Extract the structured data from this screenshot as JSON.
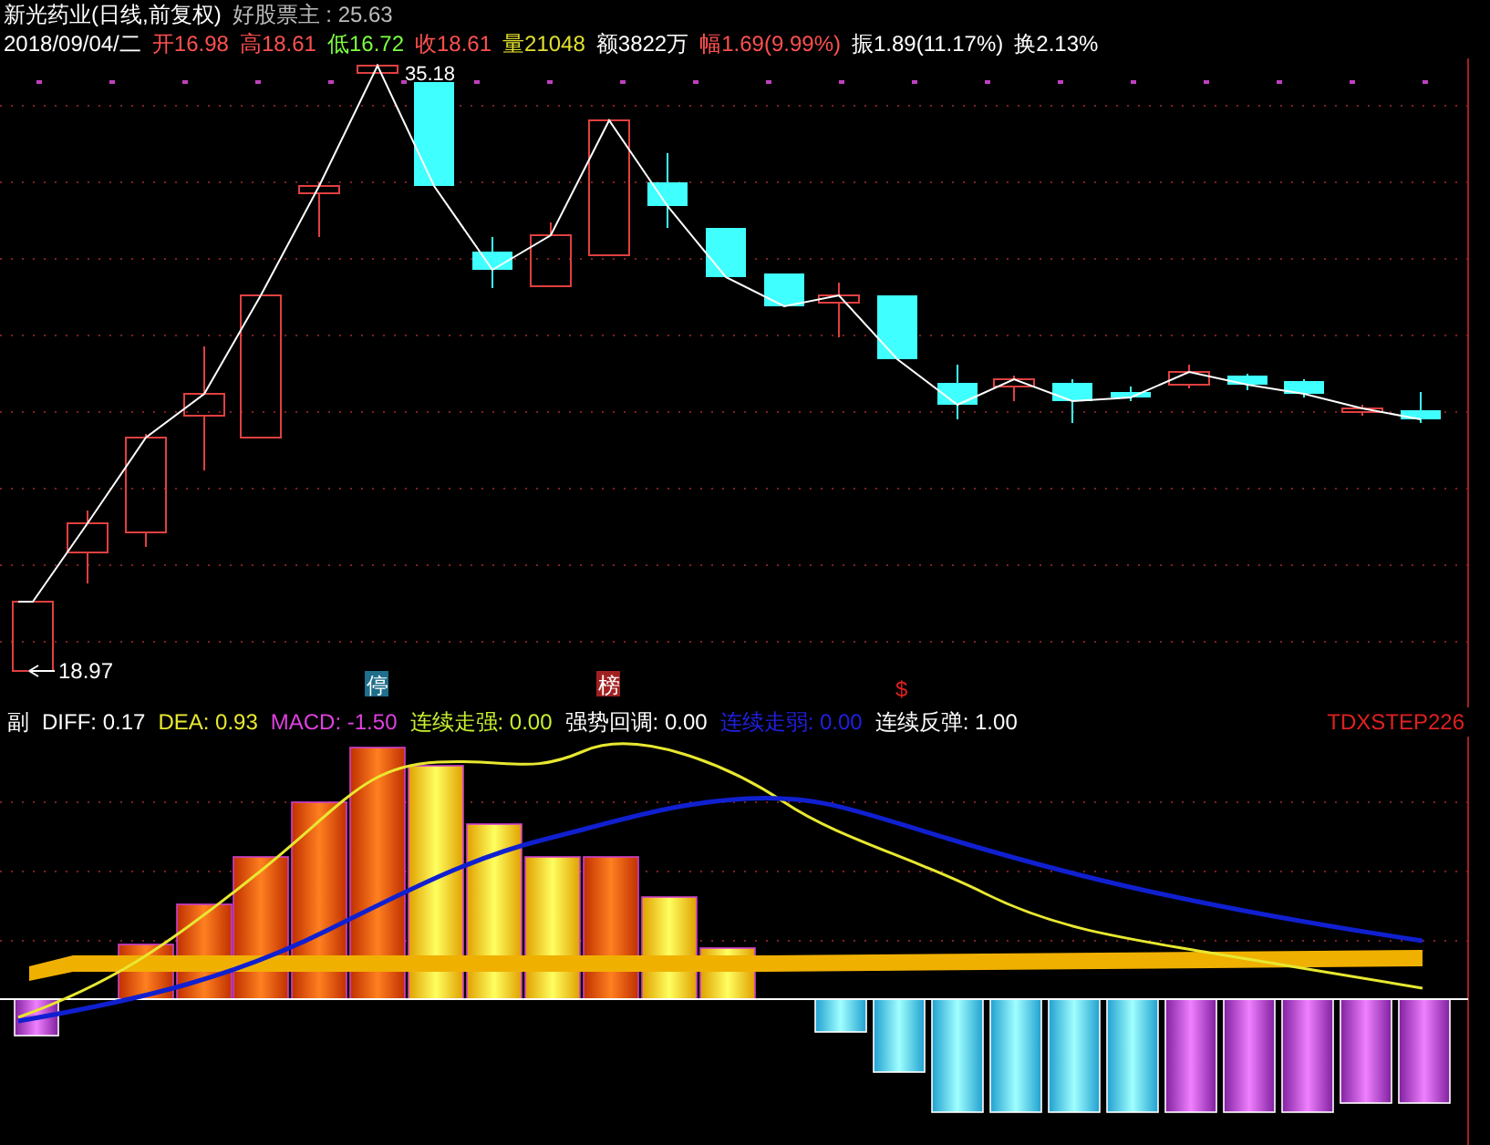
{
  "title": "新光药业(日线,前复权)",
  "indicator": "好股票主 : 25.63",
  "quote": [
    {
      "text": "2018/09/04/二",
      "color": "#ffffff"
    },
    {
      "text": "开16.98",
      "color": "#ff5050"
    },
    {
      "text": "高18.61",
      "color": "#ff5050"
    },
    {
      "text": "低16.72",
      "color": "#7cff40"
    },
    {
      "text": "收18.61",
      "color": "#ff5050"
    },
    {
      "text": "量21048",
      "color": "#e0e030"
    },
    {
      "text": "额3822万",
      "color": "#ffffff"
    },
    {
      "text": "幅1.69(9.99%)",
      "color": "#ff5050"
    },
    {
      "text": "振1.89(11.17%)",
      "color": "#ffffff"
    },
    {
      "text": "换2.13%",
      "color": "#ffffff"
    }
  ],
  "high_label": "35.18",
  "low_label": "18.97",
  "markers": [
    {
      "text": "停",
      "color": "#1e6e8c"
    },
    {
      "text": "榜",
      "color": "#a02020"
    },
    {
      "text": "$",
      "color": "#000000"
    }
  ],
  "panel_label": "副",
  "readings": [
    {
      "text": "DIFF: 0.17",
      "color": "#ffffff"
    },
    {
      "text": "DEA: 0.93",
      "color": "#e8e830"
    },
    {
      "text": "MACD: -1.50",
      "color": "#e040e0"
    },
    {
      "text": "连续走强: 0.00",
      "color": "#c8f030"
    },
    {
      "text": "强势回调: 0.00",
      "color": "#ffffff"
    },
    {
      "text": "连续走弱: 0.00",
      "color": "#2020e0"
    },
    {
      "text": "连续反弹: 1.00",
      "color": "#ffffff"
    }
  ],
  "formula_name": "TDXSTEP226"
}
